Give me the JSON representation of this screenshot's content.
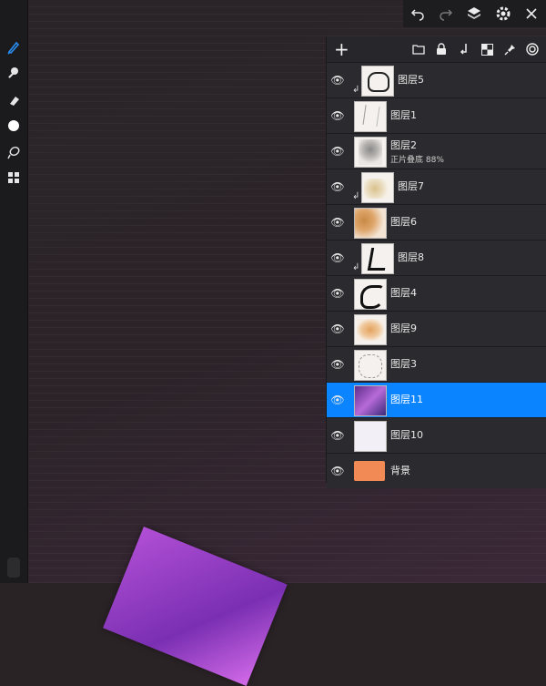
{
  "top_bar": {
    "icons": [
      "undo-icon",
      "redo-icon",
      "layers-icon",
      "settings-icon",
      "close-icon"
    ]
  },
  "tools": [
    "brush-icon",
    "smudge-icon",
    "eraser-icon",
    "color-icon",
    "lasso-icon",
    "gallery-icon"
  ],
  "layers_panel": {
    "add_label": "+",
    "header_icons": [
      "folder-icon",
      "lock-icon",
      "merge-down-icon",
      "checker-icon",
      "pin-icon",
      "spiral-icon"
    ],
    "layers": [
      {
        "name": "图层5",
        "clipped": true,
        "selected": false
      },
      {
        "name": "图层1",
        "clipped": false,
        "selected": false
      },
      {
        "name": "图层2",
        "clipped": false,
        "selected": false,
        "sub": "正片叠底  88%"
      },
      {
        "name": "图层7",
        "clipped": true,
        "selected": false
      },
      {
        "name": "图层6",
        "clipped": false,
        "selected": false
      },
      {
        "name": "图层8",
        "clipped": true,
        "selected": false
      },
      {
        "name": "图层4",
        "clipped": false,
        "selected": false
      },
      {
        "name": "图层9",
        "clipped": false,
        "selected": false
      },
      {
        "name": "图层3",
        "clipped": false,
        "selected": false
      },
      {
        "name": "图层11",
        "clipped": false,
        "selected": true
      },
      {
        "name": "图层10",
        "clipped": false,
        "selected": false
      },
      {
        "name": "背景",
        "clipped": false,
        "selected": false,
        "background_color": "#f28a55"
      }
    ]
  },
  "colors": {
    "accent": "#0a84ff",
    "panel_bg": "#27262a",
    "toolbar_bg": "#1b1b1d"
  }
}
